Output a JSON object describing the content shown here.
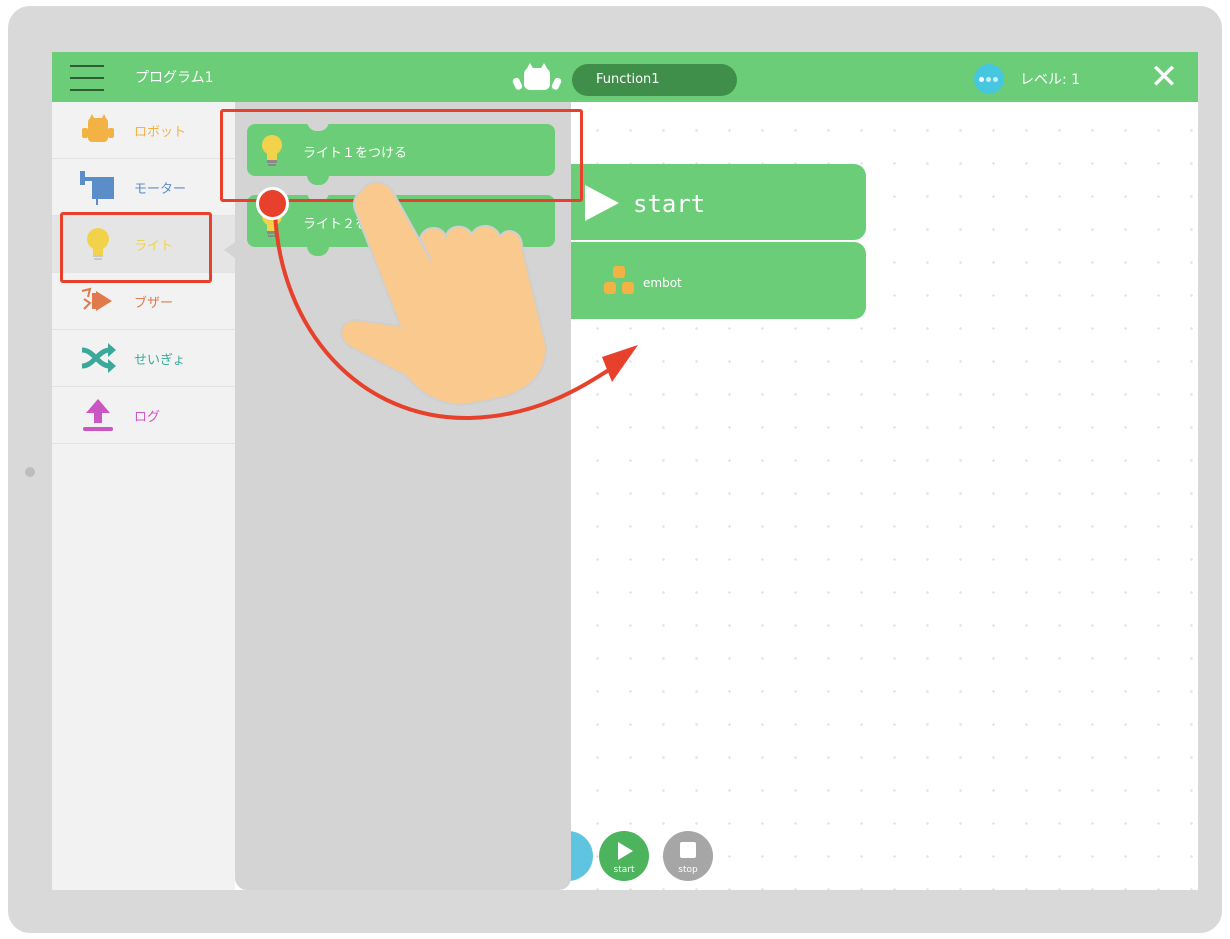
{
  "colors": {
    "header": "#6ccd78",
    "function_pill": "#3f8e49",
    "highlight": "#e8412b",
    "block": "#6ccd78"
  },
  "header": {
    "program_name": "プログラム1",
    "function_name": "Function1",
    "level_label": "レベル: 1",
    "close_label": "✕"
  },
  "sidebar": {
    "items": [
      {
        "label": "ロボット",
        "icon": "robot-icon",
        "color": "#f2b244"
      },
      {
        "label": "モーター",
        "icon": "motor-icon",
        "color": "#5b8ec9"
      },
      {
        "label": "ライト",
        "icon": "light-bulb-icon",
        "color": "#f3d24b"
      },
      {
        "label": "ブザー",
        "icon": "buzzer-icon",
        "color": "#e0794b"
      },
      {
        "label": "せいぎょ",
        "icon": "shuffle-icon",
        "color": "#3aa99a"
      },
      {
        "label": "ログ",
        "icon": "upload-icon",
        "color": "#cc55c4"
      }
    ]
  },
  "palette": {
    "blocks": [
      {
        "label": "ライト１をつける",
        "icon": "light-bulb-icon"
      },
      {
        "label": "ライト２をつける",
        "icon": "light-bulb-icon"
      }
    ]
  },
  "workspace": {
    "start_block_label": "start",
    "embot_block_label": "embot"
  },
  "controls": {
    "start_label": "start",
    "stop_label": "stop"
  }
}
